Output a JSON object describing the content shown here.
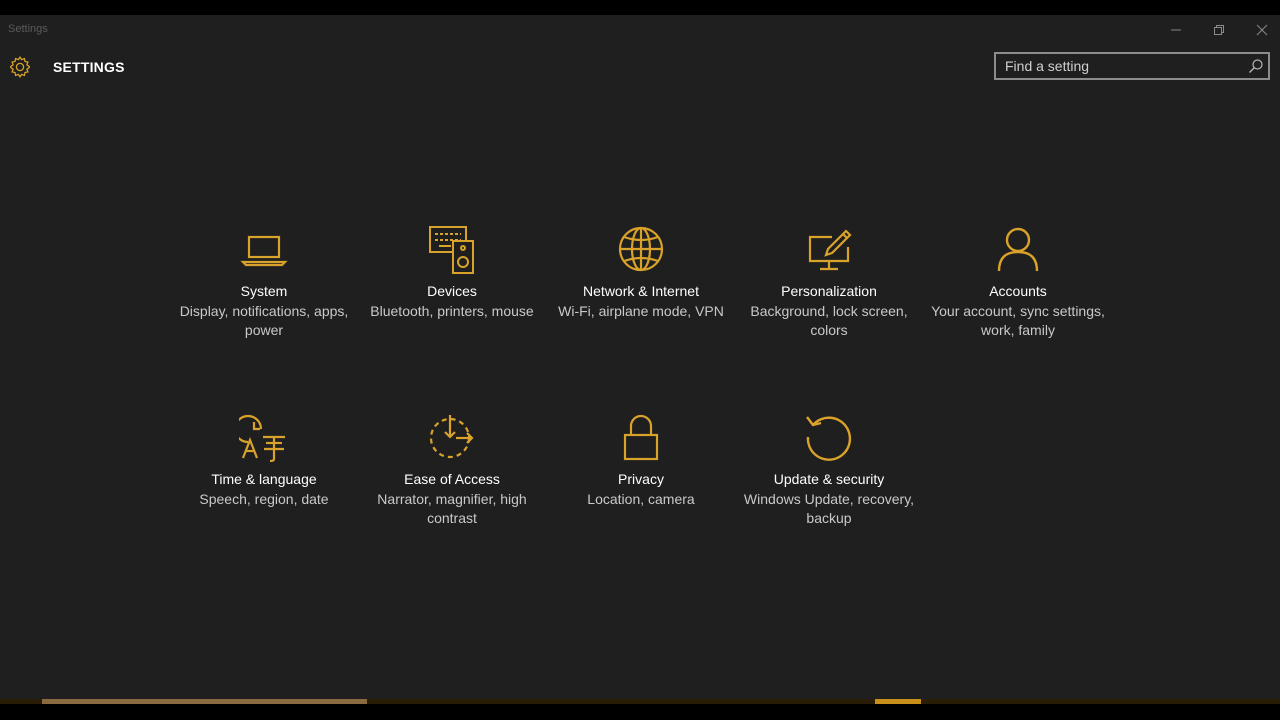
{
  "window": {
    "title": "Settings",
    "controls": [
      "minimize",
      "maximize",
      "close"
    ]
  },
  "header": {
    "app_title": "SETTINGS",
    "icon": "gear-icon"
  },
  "search": {
    "placeholder": "Find a setting",
    "value": ""
  },
  "accent_color": "#d9a22a",
  "tiles": [
    {
      "title": "System",
      "description": "Display, notifications, apps, power",
      "icon": "laptop-icon"
    },
    {
      "title": "Devices",
      "description": "Bluetooth, printers, mouse",
      "icon": "devices-icon"
    },
    {
      "title": "Network & Internet",
      "description": "Wi-Fi, airplane mode, VPN",
      "icon": "globe-icon"
    },
    {
      "title": "Personalization",
      "description": "Background, lock screen, colors",
      "icon": "personalization-icon"
    },
    {
      "title": "Accounts",
      "description": "Your account, sync settings, work, family",
      "icon": "person-icon"
    },
    {
      "title": "Time & language",
      "description": "Speech, region, date",
      "icon": "time-language-icon"
    },
    {
      "title": "Ease of Access",
      "description": "Narrator, magnifier, high contrast",
      "icon": "ease-of-access-icon"
    },
    {
      "title": "Privacy",
      "description": "Location, camera",
      "icon": "lock-icon"
    },
    {
      "title": "Update & security",
      "description": "Windows Update, recovery, backup",
      "icon": "update-icon"
    }
  ]
}
